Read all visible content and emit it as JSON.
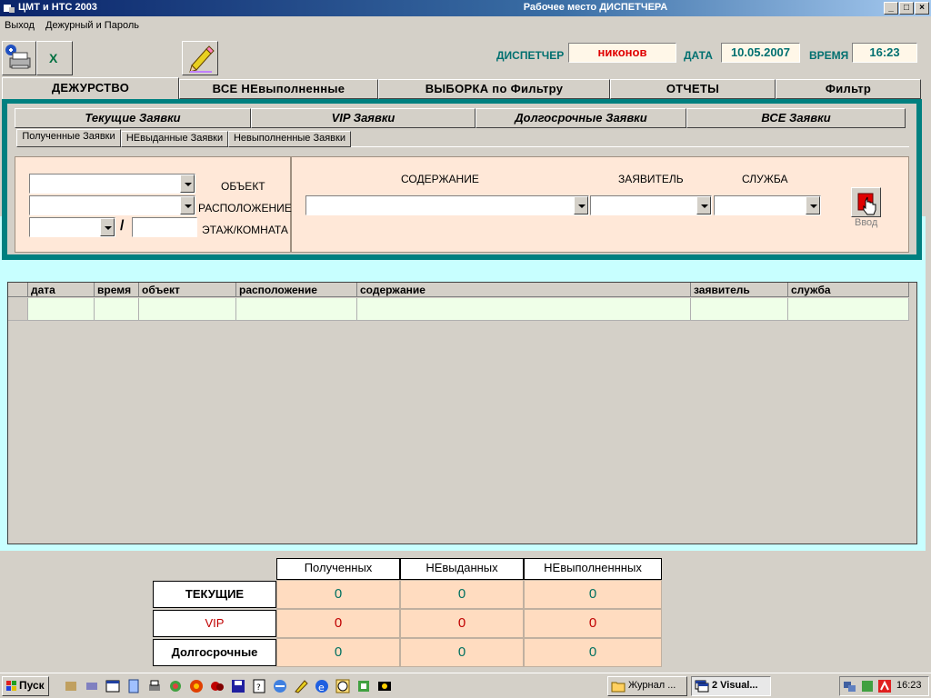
{
  "window": {
    "app_title": "ЦМТ и НТС 2003",
    "title": "Рабочее место ДИСПЕТЧЕРА",
    "btn_min": "_",
    "btn_max": "□",
    "btn_close": "×"
  },
  "menu": {
    "items": [
      "Выход",
      "Дежурный и Пароль"
    ]
  },
  "header": {
    "dispatcher_label": "ДИСПЕТЧЕР",
    "dispatcher_value": "никонов",
    "date_label": "ДАТА",
    "date_value": "10.05.2007",
    "time_label": "ВРЕМЯ",
    "time_value": "16:23"
  },
  "main_tabs": [
    "ДЕЖУРСТВО",
    "ВСЕ НЕвыполненные",
    "ВЫБОРКА по Фильтру",
    "ОТЧЕТЫ",
    "Фильтр"
  ],
  "sub_tabs": [
    "Текущие Заявки",
    "VIP Заявки",
    "Долгосрочные Заявки",
    "ВСЕ Заявки"
  ],
  "third_tabs": [
    "Полученные Заявки",
    "НЕвыданные Заявки",
    "Невыполненные Заявки"
  ],
  "form": {
    "object_label": "ОБЪЕКТ",
    "location_label": "РАСПОЛОЖЕНИЕ",
    "floor_label": "ЭТАЖ/КОМНАТА",
    "slash": "/",
    "content_label": "СОДЕРЖАНИЕ",
    "applicant_label": "ЗАЯВИТЕЛЬ",
    "service_label": "СЛУЖБА",
    "enter_label": "Ввод"
  },
  "grid": {
    "columns": [
      "дата",
      "время",
      "объект",
      "расположение",
      "содержание",
      "заявитель",
      "служба"
    ]
  },
  "stats": {
    "columns": [
      "Полученных",
      "НЕвыданных",
      "НЕвыполненнных"
    ],
    "rows": [
      {
        "label": "ТЕКУЩИЕ",
        "values": [
          "0",
          "0",
          "0"
        ]
      },
      {
        "label": "VIP",
        "values": [
          "0",
          "0",
          "0"
        ]
      },
      {
        "label": "Долгосрочные",
        "values": [
          "0",
          "0",
          "0"
        ]
      }
    ],
    "colors": {
      "normal": "#007060",
      "vip": "#c00000"
    }
  },
  "taskbar": {
    "start_label": "Пуск",
    "tasks": [
      "Журнал ...",
      "2 Visual..."
    ],
    "clock": "16:23"
  }
}
